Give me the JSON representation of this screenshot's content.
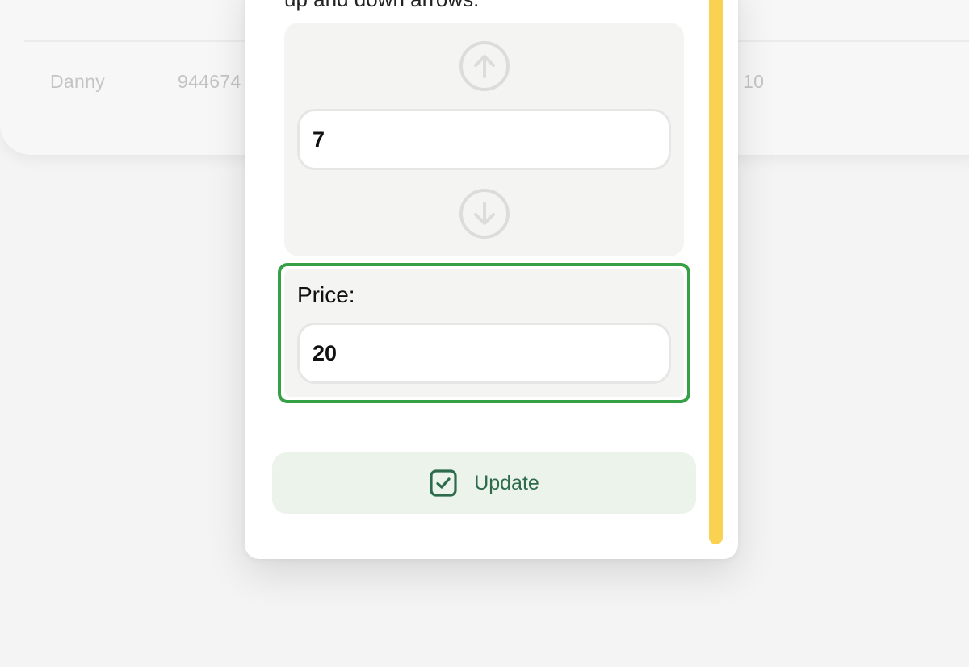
{
  "background_table": {
    "row": {
      "name": "Danny",
      "phone_partial": "944674",
      "quantity": "10"
    }
  },
  "modal": {
    "instruction_text": "up and down arrows:",
    "stepper": {
      "up_icon": "arrow-up-circle",
      "down_icon": "arrow-down-circle",
      "value": "7"
    },
    "price": {
      "label": "Price:",
      "value": "20"
    },
    "update_button": {
      "label": "Update",
      "icon": "checkbox-check"
    }
  },
  "colors": {
    "highlight_border": "#36a046",
    "scrollbar": "#f8d250",
    "button_background": "#ebf3ea",
    "button_text": "#2e6b4d",
    "panel_background": "#f4f4f2"
  }
}
